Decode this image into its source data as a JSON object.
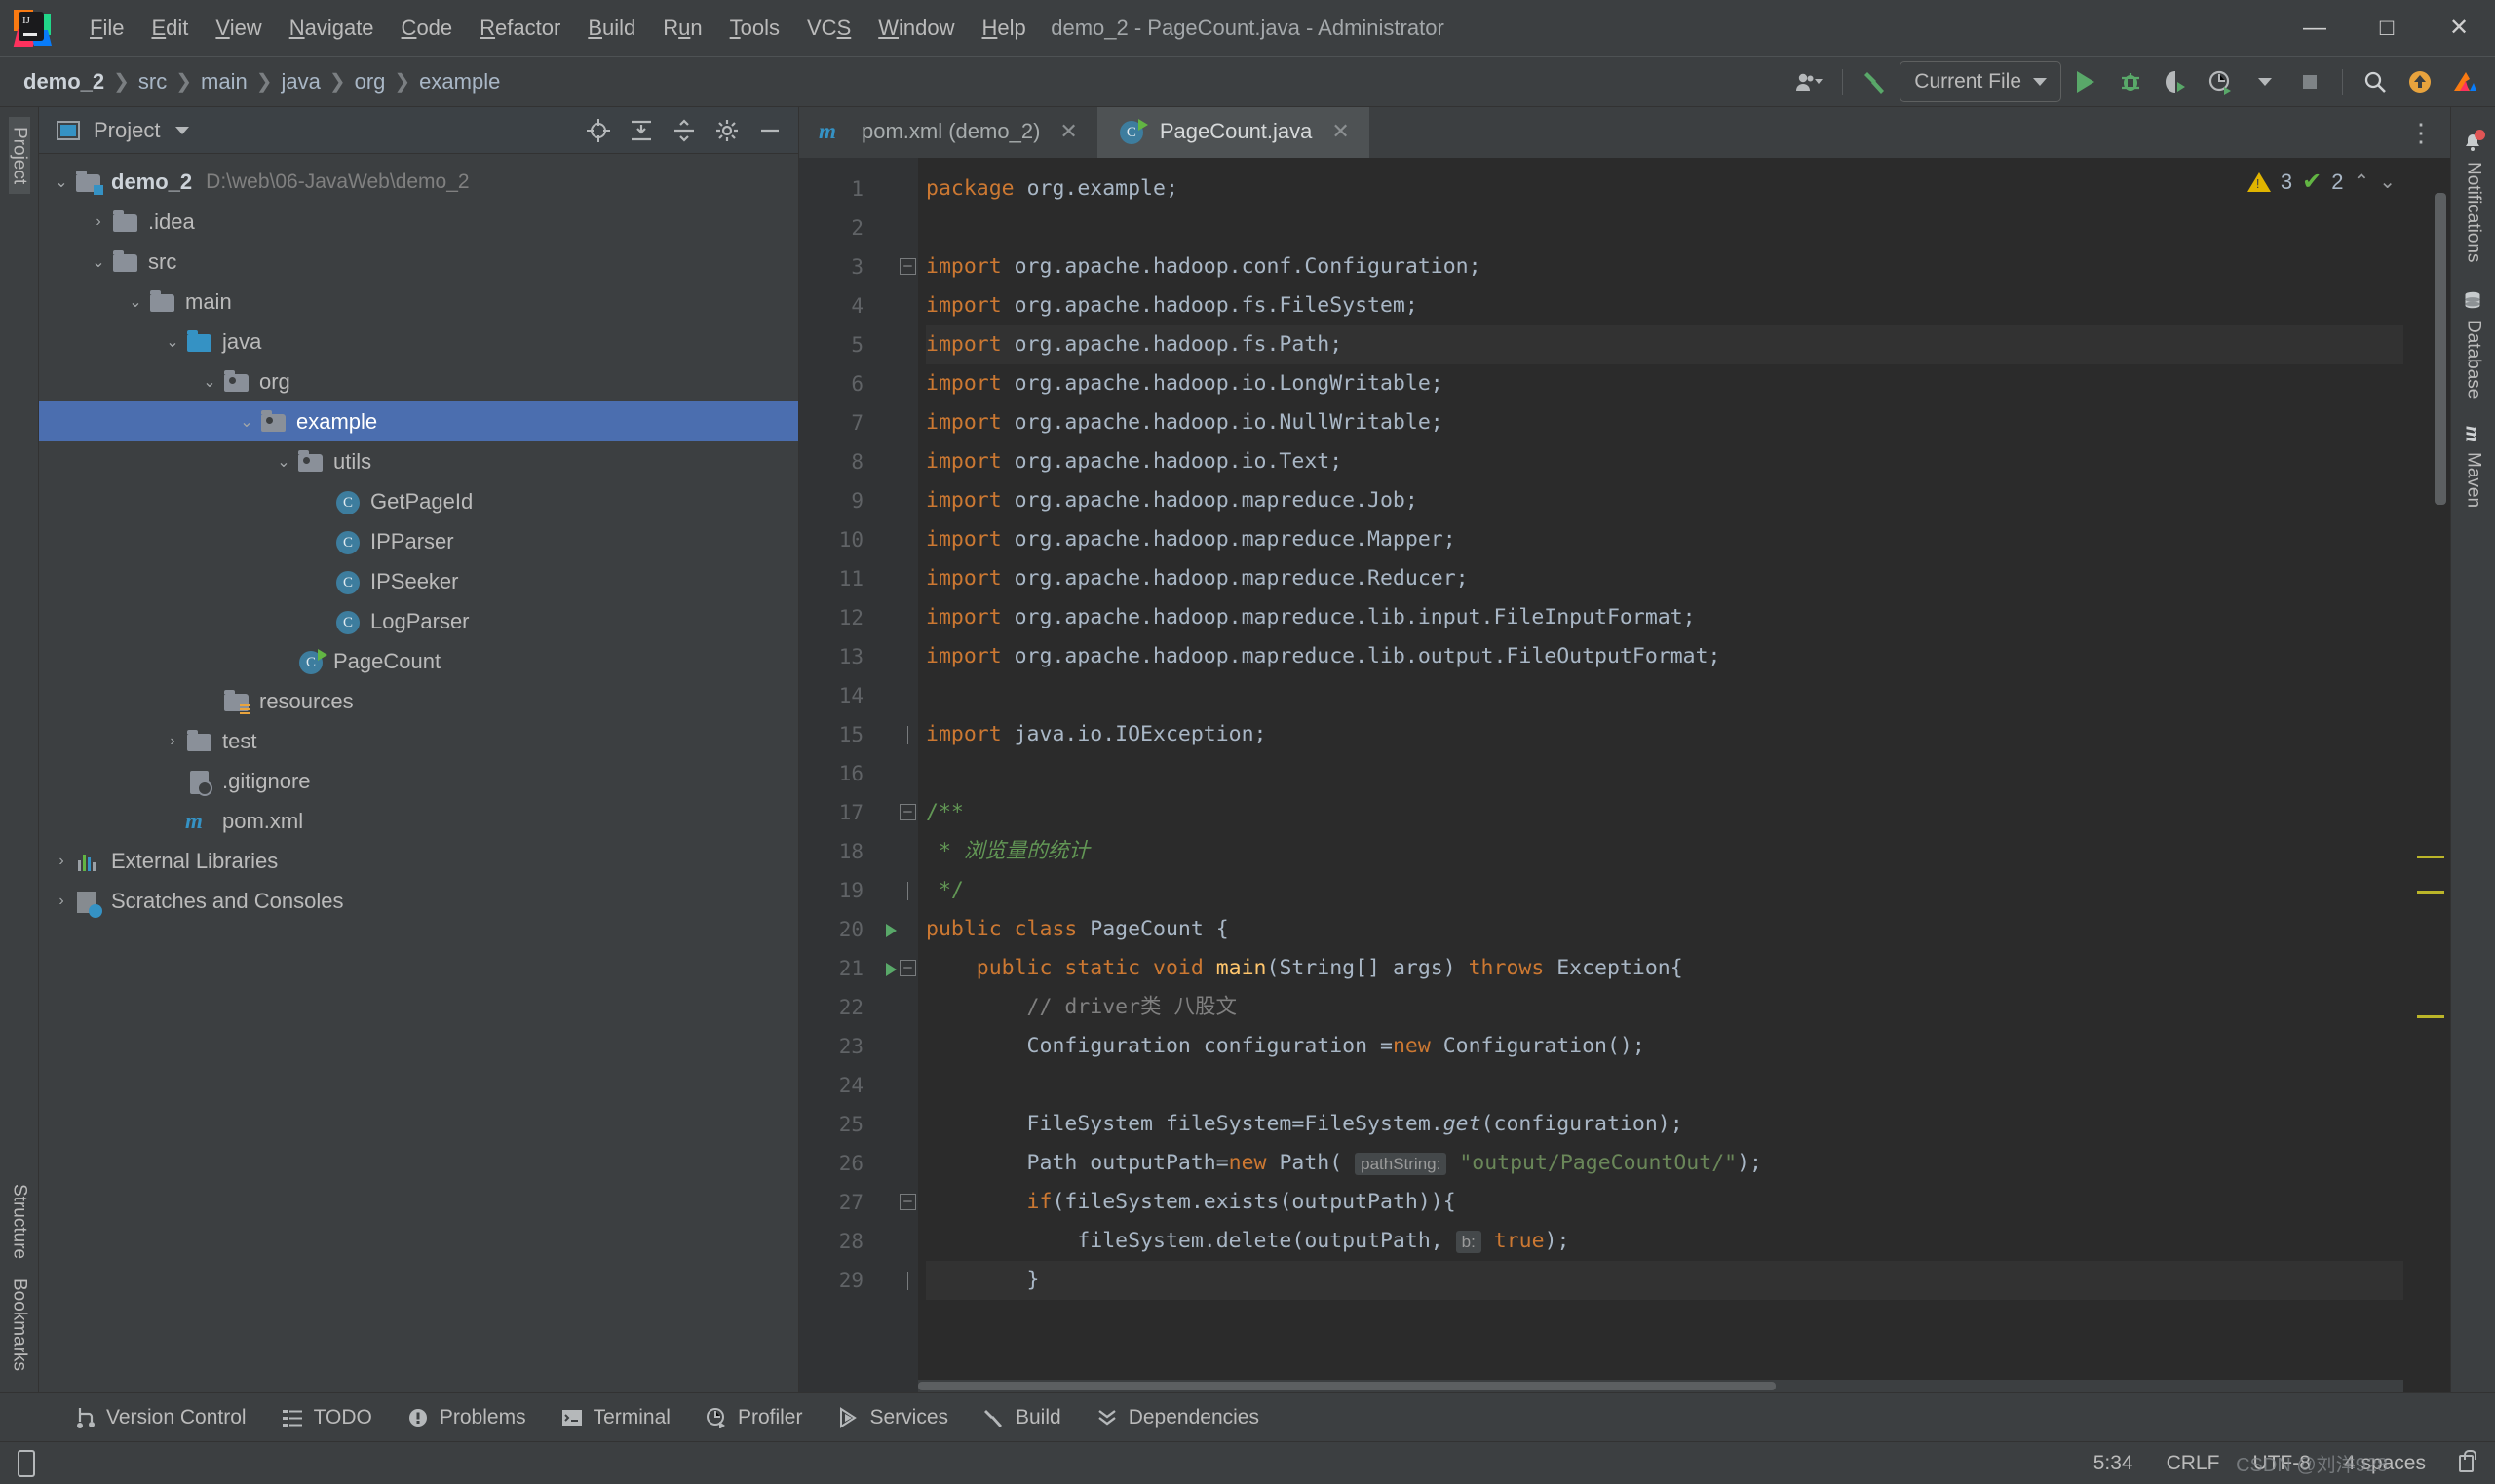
{
  "window": {
    "title": "demo_2 - PageCount.java - Administrator",
    "minimize": "—",
    "maximize": "□",
    "close": "✕"
  },
  "menu": [
    {
      "label": "File",
      "mnemonic": "F"
    },
    {
      "label": "Edit",
      "mnemonic": "E"
    },
    {
      "label": "View",
      "mnemonic": "V"
    },
    {
      "label": "Navigate",
      "mnemonic": "N"
    },
    {
      "label": "Code",
      "mnemonic": "C"
    },
    {
      "label": "Refactor",
      "mnemonic": "R"
    },
    {
      "label": "Build",
      "mnemonic": "B"
    },
    {
      "label": "Run",
      "mnemonic": "u"
    },
    {
      "label": "Tools",
      "mnemonic": "T"
    },
    {
      "label": "VCS",
      "mnemonic": "S"
    },
    {
      "label": "Window",
      "mnemonic": "W"
    },
    {
      "label": "Help",
      "mnemonic": "H"
    }
  ],
  "navbar": {
    "breadcrumbs": [
      "demo_2",
      "src",
      "main",
      "java",
      "org",
      "example"
    ],
    "separator": "❯",
    "run_config": "Current File",
    "icons": [
      "user-avatar-icon",
      "hammer-build-icon",
      "run-icon",
      "debug-icon",
      "run-coverage-icon",
      "profiler-icon",
      "stop-icon",
      "search-icon",
      "update-icon",
      "ide-settings-icon"
    ]
  },
  "left_stripe": {
    "top_label": "Project",
    "bottom_labels": [
      "Structure",
      "Bookmarks"
    ]
  },
  "project_panel": {
    "title": "Project",
    "header_icons": [
      "locate-target-icon",
      "expand-all-icon",
      "collapse-all-icon",
      "settings-gear-icon",
      "hide-panel-icon"
    ],
    "tree": [
      {
        "label": "demo_2",
        "path": "D:\\web\\06-JavaWeb\\demo_2",
        "indent": 0,
        "twist": "v",
        "icon": "module-folder-icon",
        "bold": true,
        "selected": false
      },
      {
        "label": ".idea",
        "path": "",
        "indent": 1,
        "twist": ">",
        "icon": "folder-icon",
        "bold": false,
        "selected": false
      },
      {
        "label": "src",
        "path": "",
        "indent": 1,
        "twist": "v",
        "icon": "folder-icon",
        "bold": false,
        "selected": false
      },
      {
        "label": "main",
        "path": "",
        "indent": 2,
        "twist": "v",
        "icon": "folder-icon",
        "bold": false,
        "selected": false
      },
      {
        "label": "java",
        "path": "",
        "indent": 3,
        "twist": "v",
        "icon": "source-root-folder-icon",
        "bold": false,
        "selected": false
      },
      {
        "label": "org",
        "path": "",
        "indent": 4,
        "twist": "v",
        "icon": "package-folder-icon",
        "bold": false,
        "selected": false
      },
      {
        "label": "example",
        "path": "",
        "indent": 5,
        "twist": "v",
        "icon": "package-folder-icon",
        "bold": false,
        "selected": true
      },
      {
        "label": "utils",
        "path": "",
        "indent": 6,
        "twist": "v",
        "icon": "package-folder-icon",
        "bold": false,
        "selected": false
      },
      {
        "label": "GetPageId",
        "path": "",
        "indent": 7,
        "twist": "",
        "icon": "java-class-icon",
        "bold": false,
        "selected": false
      },
      {
        "label": "IPParser",
        "path": "",
        "indent": 7,
        "twist": "",
        "icon": "java-class-icon",
        "bold": false,
        "selected": false
      },
      {
        "label": "IPSeeker",
        "path": "",
        "indent": 7,
        "twist": "",
        "icon": "java-class-icon",
        "bold": false,
        "selected": false
      },
      {
        "label": "LogParser",
        "path": "",
        "indent": 7,
        "twist": "",
        "icon": "java-class-icon",
        "bold": false,
        "selected": false
      },
      {
        "label": "PageCount",
        "path": "",
        "indent": 6,
        "twist": "",
        "icon": "java-runnable-class-icon",
        "bold": false,
        "selected": false
      },
      {
        "label": "resources",
        "path": "",
        "indent": 4,
        "twist": "",
        "icon": "resources-folder-icon",
        "bold": false,
        "selected": false
      },
      {
        "label": "test",
        "path": "",
        "indent": 3,
        "twist": ">",
        "icon": "folder-icon",
        "bold": false,
        "selected": false
      },
      {
        "label": ".gitignore",
        "path": "",
        "indent": 3,
        "twist": "",
        "icon": "gitignore-file-icon",
        "bold": false,
        "selected": false
      },
      {
        "label": "pom.xml",
        "path": "",
        "indent": 3,
        "twist": "",
        "icon": "maven-file-icon",
        "bold": false,
        "selected": false
      },
      {
        "label": "External Libraries",
        "path": "",
        "indent": 0,
        "twist": ">",
        "icon": "external-libraries-icon",
        "bold": false,
        "selected": false
      },
      {
        "label": "Scratches and Consoles",
        "path": "",
        "indent": 0,
        "twist": ">",
        "icon": "scratches-icon",
        "bold": false,
        "selected": false
      }
    ]
  },
  "editor": {
    "tabs": [
      {
        "label": "pom.xml (demo_2)",
        "icon": "maven-file-icon",
        "active": false,
        "close": "✕"
      },
      {
        "label": "PageCount.java",
        "icon": "java-runnable-class-icon",
        "active": true,
        "close": "✕"
      }
    ],
    "inspection": {
      "warning_count": "3",
      "ok_count": "2",
      "up": "⌃",
      "down": "⌄"
    },
    "lines": [
      {
        "n": "1",
        "runmark": false,
        "fold": "",
        "hl": false,
        "tokens": [
          {
            "t": "package ",
            "c": "k"
          },
          {
            "t": "org.example;",
            "c": ""
          }
        ]
      },
      {
        "n": "2",
        "runmark": false,
        "fold": "",
        "hl": false,
        "tokens": []
      },
      {
        "n": "3",
        "runmark": false,
        "fold": "minus",
        "hl": false,
        "tokens": [
          {
            "t": "import ",
            "c": "k"
          },
          {
            "t": "org.apache.hadoop.conf.Configuration;",
            "c": ""
          }
        ]
      },
      {
        "n": "4",
        "runmark": false,
        "fold": "",
        "hl": false,
        "tokens": [
          {
            "t": "import ",
            "c": "k"
          },
          {
            "t": "org.apache.hadoop.fs.FileSystem;",
            "c": ""
          }
        ]
      },
      {
        "n": "5",
        "runmark": false,
        "fold": "",
        "hl": true,
        "tokens": [
          {
            "t": "import ",
            "c": "k"
          },
          {
            "t": "org.apache.hadoop.fs.Path;",
            "c": ""
          }
        ]
      },
      {
        "n": "6",
        "runmark": false,
        "fold": "",
        "hl": false,
        "tokens": [
          {
            "t": "import ",
            "c": "k"
          },
          {
            "t": "org.apache.hadoop.io.LongWritable;",
            "c": ""
          }
        ]
      },
      {
        "n": "7",
        "runmark": false,
        "fold": "",
        "hl": false,
        "tokens": [
          {
            "t": "import ",
            "c": "k"
          },
          {
            "t": "org.apache.hadoop.io.NullWritable;",
            "c": ""
          }
        ]
      },
      {
        "n": "8",
        "runmark": false,
        "fold": "",
        "hl": false,
        "tokens": [
          {
            "t": "import ",
            "c": "k"
          },
          {
            "t": "org.apache.hadoop.io.Text;",
            "c": ""
          }
        ]
      },
      {
        "n": "9",
        "runmark": false,
        "fold": "",
        "hl": false,
        "tokens": [
          {
            "t": "import ",
            "c": "k"
          },
          {
            "t": "org.apache.hadoop.mapreduce.Job;",
            "c": ""
          }
        ]
      },
      {
        "n": "10",
        "runmark": false,
        "fold": "",
        "hl": false,
        "tokens": [
          {
            "t": "import ",
            "c": "k"
          },
          {
            "t": "org.apache.hadoop.mapreduce.Mapper;",
            "c": ""
          }
        ]
      },
      {
        "n": "11",
        "runmark": false,
        "fold": "",
        "hl": false,
        "tokens": [
          {
            "t": "import ",
            "c": "k"
          },
          {
            "t": "org.apache.hadoop.mapreduce.Reducer;",
            "c": ""
          }
        ]
      },
      {
        "n": "12",
        "runmark": false,
        "fold": "",
        "hl": false,
        "tokens": [
          {
            "t": "import ",
            "c": "k"
          },
          {
            "t": "org.apache.hadoop.mapreduce.lib.input.FileInputFormat;",
            "c": ""
          }
        ]
      },
      {
        "n": "13",
        "runmark": false,
        "fold": "",
        "hl": false,
        "tokens": [
          {
            "t": "import ",
            "c": "k"
          },
          {
            "t": "org.apache.hadoop.mapreduce.lib.output.FileOutputFormat;",
            "c": ""
          }
        ]
      },
      {
        "n": "14",
        "runmark": false,
        "fold": "",
        "hl": false,
        "tokens": []
      },
      {
        "n": "15",
        "runmark": false,
        "fold": "bottom",
        "hl": false,
        "tokens": [
          {
            "t": "import ",
            "c": "k"
          },
          {
            "t": "java.io.IOException;",
            "c": ""
          }
        ]
      },
      {
        "n": "16",
        "runmark": false,
        "fold": "",
        "hl": false,
        "tokens": []
      },
      {
        "n": "17",
        "runmark": false,
        "fold": "minus",
        "hl": false,
        "tokens": [
          {
            "t": "/**",
            "c": "docg"
          }
        ]
      },
      {
        "n": "18",
        "runmark": false,
        "fold": "",
        "hl": false,
        "tokens": [
          {
            "t": " * ",
            "c": "docg"
          },
          {
            "t": "浏览量的统计",
            "c": "doc"
          }
        ]
      },
      {
        "n": "19",
        "runmark": false,
        "fold": "bottom",
        "hl": false,
        "tokens": [
          {
            "t": " */",
            "c": "docg"
          }
        ]
      },
      {
        "n": "20",
        "runmark": true,
        "fold": "",
        "hl": false,
        "tokens": [
          {
            "t": "public class ",
            "c": "k"
          },
          {
            "t": "PageCount {",
            "c": ""
          }
        ]
      },
      {
        "n": "21",
        "runmark": true,
        "fold": "minus",
        "hl": false,
        "tokens": [
          {
            "t": "    public static void ",
            "c": "k"
          },
          {
            "t": "main",
            "c": "mth"
          },
          {
            "t": "(String[] args) ",
            "c": ""
          },
          {
            "t": "throws ",
            "c": "k"
          },
          {
            "t": "Exception{",
            "c": ""
          }
        ]
      },
      {
        "n": "22",
        "runmark": false,
        "fold": "",
        "hl": false,
        "tokens": [
          {
            "t": "        // driver类 八股文",
            "c": "cm"
          }
        ]
      },
      {
        "n": "23",
        "runmark": false,
        "fold": "",
        "hl": false,
        "tokens": [
          {
            "t": "        Configuration configuration =",
            "c": ""
          },
          {
            "t": "new ",
            "c": "k"
          },
          {
            "t": "Configuration();",
            "c": ""
          }
        ]
      },
      {
        "n": "24",
        "runmark": false,
        "fold": "",
        "hl": false,
        "tokens": []
      },
      {
        "n": "25",
        "runmark": false,
        "fold": "",
        "hl": false,
        "tokens": [
          {
            "t": "        FileSystem fileSystem=FileSystem.",
            "c": ""
          },
          {
            "t": "get",
            "c": "it"
          },
          {
            "t": "(configuration);",
            "c": ""
          }
        ]
      },
      {
        "n": "26",
        "runmark": false,
        "fold": "",
        "hl": false,
        "tokens": [
          {
            "t": "        Path outputPath=",
            "c": ""
          },
          {
            "t": "new ",
            "c": "k"
          },
          {
            "t": "Path( ",
            "c": ""
          },
          {
            "t": "pathString:",
            "c": "hint"
          },
          {
            "t": " ",
            "c": ""
          },
          {
            "t": "\"output/PageCountOut/\"",
            "c": "s"
          },
          {
            "t": ");",
            "c": ""
          }
        ]
      },
      {
        "n": "27",
        "runmark": false,
        "fold": "minus",
        "hl": false,
        "tokens": [
          {
            "t": "        if",
            "c": "k"
          },
          {
            "t": "(fileSystem.exists(outputPath)){",
            "c": ""
          }
        ]
      },
      {
        "n": "28",
        "runmark": false,
        "fold": "",
        "hl": false,
        "tokens": [
          {
            "t": "            fileSystem.delete(outputPath, ",
            "c": ""
          },
          {
            "t": "b:",
            "c": "hint"
          },
          {
            "t": " ",
            "c": ""
          },
          {
            "t": "true",
            "c": "k"
          },
          {
            "t": ");",
            "c": ""
          }
        ]
      },
      {
        "n": "29",
        "runmark": false,
        "fold": "bottom",
        "hl": true,
        "tokens": [
          {
            "t": "        }",
            "c": ""
          }
        ]
      }
    ]
  },
  "right_stripe": {
    "items": [
      {
        "label": "Notifications",
        "icon": "bell-notification-icon"
      },
      {
        "label": "Database",
        "icon": "database-icon"
      },
      {
        "label": "Maven",
        "icon": "maven-icon"
      }
    ]
  },
  "tool_windows": [
    {
      "label": "Version Control",
      "icon": "branch-icon"
    },
    {
      "label": "TODO",
      "icon": "todo-list-icon"
    },
    {
      "label": "Problems",
      "icon": "problems-icon"
    },
    {
      "label": "Terminal",
      "icon": "terminal-icon"
    },
    {
      "label": "Profiler",
      "icon": "profiler-icon"
    },
    {
      "label": "Services",
      "icon": "services-icon"
    },
    {
      "label": "Build",
      "icon": "hammer-build-icon"
    },
    {
      "label": "Dependencies",
      "icon": "dependencies-icon"
    }
  ],
  "statusbar": {
    "left_icon": "phone-layout-icon",
    "caret_position": "5:34",
    "line_separator": "CRLF",
    "encoding": "UTF-8",
    "indent": "4 spaces",
    "lock_icon": "read-only-lock-icon",
    "watermark": "CSDN @刘洋928"
  },
  "colors": {
    "accent_blue": "#4b6eaf",
    "run_green": "#59a869",
    "warning_yellow": "#e0b400",
    "keyword_orange": "#cc7832",
    "string_green": "#6a8759",
    "comment_gray": "#808080",
    "doc_green": "#629755",
    "panel_bg": "#3c3f41",
    "editor_bg": "#2b2b2b",
    "gutter_bg": "#313335"
  }
}
